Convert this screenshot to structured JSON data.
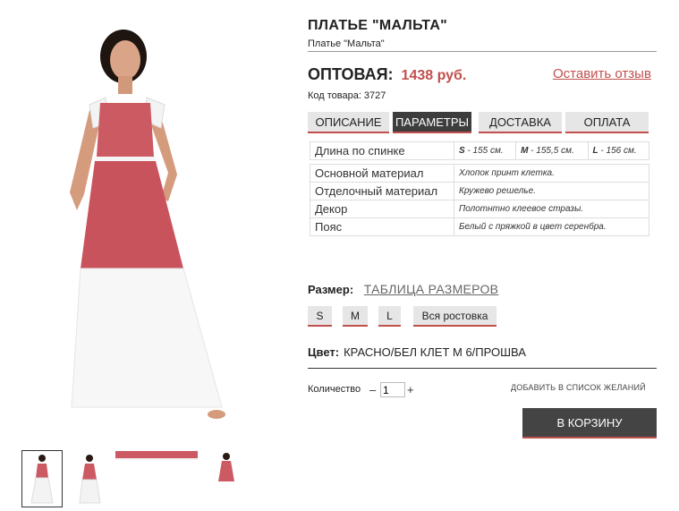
{
  "product": {
    "title": "ПЛАТЬЕ \"МАЛЬТА\"",
    "subtitle": "Платье \"Мальта\"",
    "price_label": "ОПТОВАЯ:",
    "price_value": "1438 руб.",
    "review_link": "Оставить отзыв",
    "sku_label": "Код товара:",
    "sku_value": "3727"
  },
  "tabs": [
    {
      "label": "ОПИСАНИЕ",
      "active": false
    },
    {
      "label": "ПАРАМЕТРЫ",
      "active": true
    },
    {
      "label": "ДОСТАВКА",
      "active": false
    },
    {
      "label": "ОПЛАТА",
      "active": false
    }
  ],
  "params": {
    "length_label": "Длина по спинке",
    "length_values": [
      {
        "size": "S",
        "value": " - 155 см."
      },
      {
        "size": "M",
        "value": " - 155,5 см."
      },
      {
        "size": "L",
        "value": " - 156 см."
      }
    ],
    "rows": [
      {
        "label": "Основной материал",
        "value": "Хлопок принт клетка."
      },
      {
        "label": "Отделочный материал",
        "value": "Кружево решелье."
      },
      {
        "label": "Декор",
        "value": "Полотнтно клеевое стразы."
      },
      {
        "label": "Пояс",
        "value": "Белый с пряжкой в цвет серенбра."
      }
    ]
  },
  "size": {
    "label": "Размер:",
    "table_link": "ТАБЛИЦА РАЗМЕРОВ",
    "options": [
      "S",
      "M",
      "L",
      "Вся ростовка"
    ]
  },
  "color": {
    "label": "Цвет:",
    "value": "КРАСНО/БЕЛ КЛЕТ М 6/ПРОШВА"
  },
  "quantity": {
    "label": "Количество",
    "minus": "–",
    "value": "1",
    "plus": "+"
  },
  "wishlist_label": "ДОБАВИТЬ В СПИСОК ЖЕЛАНИЙ",
  "cart_label": "В КОРЗИНУ",
  "colors": {
    "accent": "#c0504d",
    "dress_red": "#cc5a63",
    "tab_active": "#3d3d3d",
    "tab_inactive": "#e6e6e6"
  }
}
